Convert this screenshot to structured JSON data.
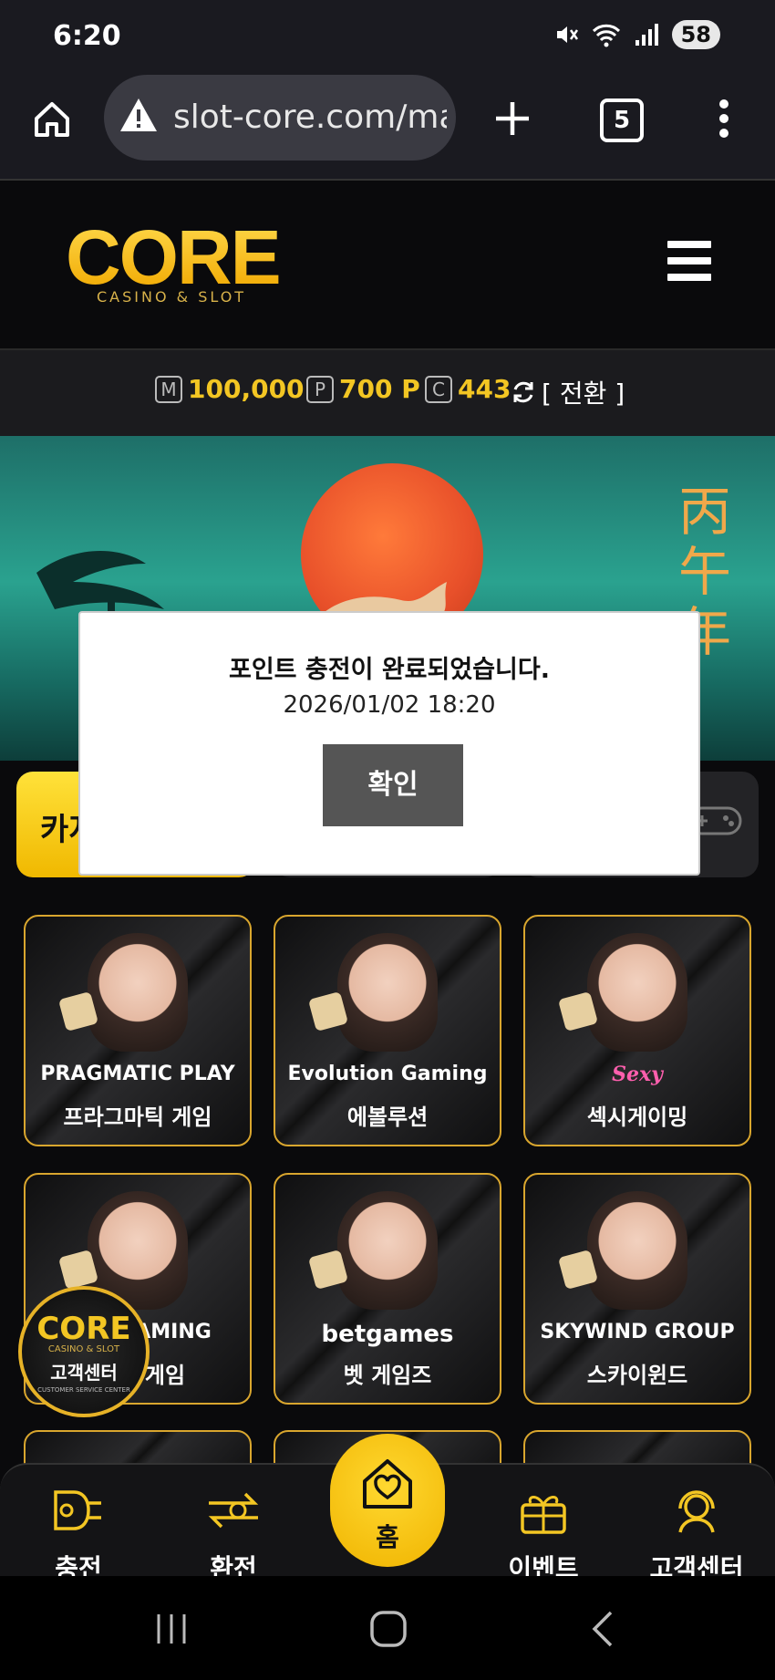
{
  "status_bar": {
    "time": "6:20",
    "battery": "58"
  },
  "browser": {
    "url": "slot-core.com/ma",
    "tab_count": "5"
  },
  "site": {
    "logo_text": "CORE",
    "logo_sub": "CASINO & SLOT",
    "balance": {
      "money_badge": "M",
      "money": "100,000",
      "point_badge": "P",
      "point": "700 P",
      "coin_badge": "C",
      "coin": "443",
      "switch_label": "[ 전환 ]"
    },
    "banner_calligraphy": "丙午年",
    "category_first_label": "카지"
  },
  "dialog": {
    "message": "포인트 충전이 완료되었습니다.",
    "timestamp": "2026/01/02 18:20",
    "confirm_label": "확인"
  },
  "games": [
    {
      "brand": "PRAGMATIC PLAY",
      "name": "프라그마틱 게임"
    },
    {
      "brand": "Evolution Gaming",
      "name": "에볼루션"
    },
    {
      "brand": "Sexy",
      "name": "섹시게이밍"
    },
    {
      "brand": "GAMING",
      "name": "게임"
    },
    {
      "brand": "betgames",
      "name": "벳 게임즈"
    },
    {
      "brand": "SKYWIND GROUP",
      "name": "스카이윈드"
    }
  ],
  "floating_cs": {
    "logo": "CORE",
    "sub": "CASINO & SLOT",
    "label": "고객센터",
    "caption": "CUSTOMER SERVICE CENTER"
  },
  "bottom_nav": {
    "charge": "충전",
    "exchange": "환전",
    "home": "홈",
    "event": "이벤트",
    "support": "고객센터"
  },
  "colors": {
    "accent": "#f3c623",
    "card_border": "#d9a62e",
    "dialog_button": "#555555"
  }
}
